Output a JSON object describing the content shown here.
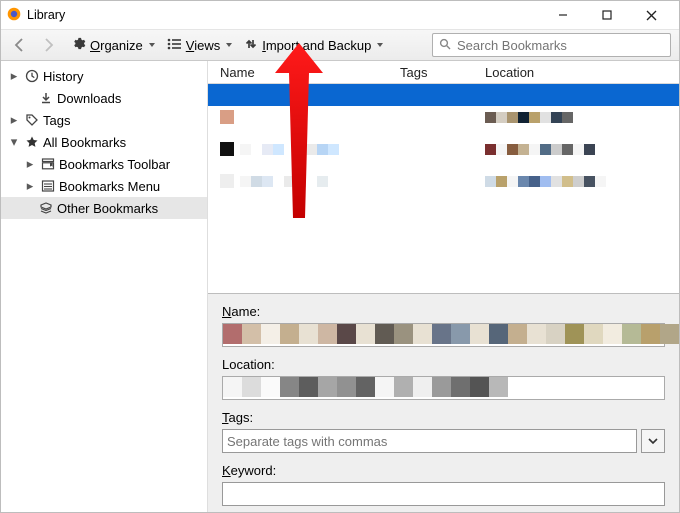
{
  "title": "Library",
  "toolbar": {
    "organize": "Organize",
    "views": "Views",
    "import_backup": "Import and Backup",
    "search_placeholder": "Search Bookmarks"
  },
  "sidebar": {
    "history": "History",
    "downloads": "Downloads",
    "tags": "Tags",
    "all_bookmarks": "All Bookmarks",
    "toolbar": "Bookmarks Toolbar",
    "menu": "Bookmarks Menu",
    "other": "Other Bookmarks"
  },
  "columns": {
    "name": "Name",
    "tags": "Tags",
    "location": "Location"
  },
  "details": {
    "name_label": "Name:",
    "location_label": "Location:",
    "tags_label": "Tags:",
    "tags_placeholder": "Separate tags with commas",
    "keyword_label": "Keyword:"
  },
  "mosaics": {
    "row1_loc": [
      "#6b5c52",
      "#d4cdc2",
      "#a9946f",
      "#112233",
      "#b9a16b",
      "#e1e1e1",
      "#334355",
      "#666666"
    ],
    "row2_icon": [
      "#111111"
    ],
    "row2_name": [
      "#f5f5f5",
      "#ffffff",
      "#e6eaf5",
      "#cfe7ff",
      "#ffffff",
      "#9fbce3",
      "#eaeaea",
      "#b7d5f5",
      "#cfe7ff",
      "#ffffff"
    ],
    "row2_loc": [
      "#7a2f2f",
      "#f5f5f5",
      "#875d3f",
      "#c4b292",
      "#f5f5f5",
      "#526c86",
      "#cccccc",
      "#666666",
      "#f5f5f5",
      "#3b4453"
    ],
    "row3_name": [
      "#f5f5f5",
      "#d0dbe5",
      "#dde7f3",
      "#ffffff",
      "#eaeaea",
      "#cfe7ff",
      "#ffffff",
      "#e6ecef"
    ],
    "row3_loc": [
      "#cfdbe6",
      "#b9a16b",
      "#f5f5f5",
      "#6a87ad",
      "#46618a",
      "#a0bdf0",
      "#e1e1e1",
      "#d1be8b",
      "#cecece",
      "#475261",
      "#f5f5f5"
    ],
    "detail_name": [
      "#b26d6d",
      "#d3bfa8",
      "#f4efe7",
      "#c4af8f",
      "#e8e1d3",
      "#ceb7a3",
      "#5a4848",
      "#e8e1d3",
      "#615b53",
      "#9a927f",
      "#e8e1d3",
      "#687489",
      "#8899ab",
      "#e8e1d3",
      "#566679",
      "#c4af8f",
      "#e8e1d3",
      "#d8d2c3",
      "#9f9357",
      "#e0d8bf",
      "#f2ece0",
      "#b5ba96",
      "#b8a06c",
      "#b1a688"
    ],
    "detail_loc": [
      "#f5f5f5",
      "#dcdcdc",
      "#fafafa",
      "#868686",
      "#5d5d5d",
      "#a6a6a6",
      "#919191",
      "#636363",
      "#f5f5f5",
      "#b0b0b0",
      "#efefef",
      "#9a9a9a",
      "#6f6f6f",
      "#545454",
      "#b8b8b8"
    ]
  }
}
